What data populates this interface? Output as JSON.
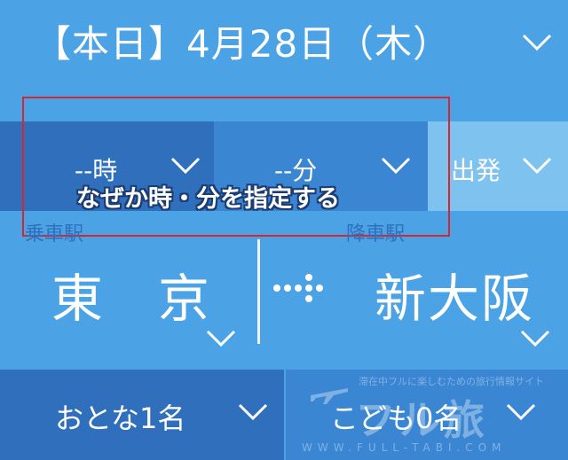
{
  "date_selector": {
    "label": "【本日】4月28日（木）",
    "icon": "chevron-down-icon"
  },
  "time_selector": {
    "hour_value": "--時",
    "minute_value": "--分",
    "type_value": "出発"
  },
  "annotation": {
    "text": "なぜか時・分を指定する",
    "border_color": "#d8262b"
  },
  "stations": {
    "departure_label": "乗車駅",
    "departure_name": "東　京",
    "arrival_label": "降車駅",
    "arrival_name": "新大阪",
    "arrow_icon": "dotted-arrow-right-icon"
  },
  "passengers": {
    "adult_label": "おとな1名",
    "child_label": "こども0名"
  },
  "watermark": {
    "tagline": "滞在中フルに楽しむための旅行情報サイト",
    "logo": "フル旅",
    "url": "WWW.FULL-TABI.COM"
  },
  "colors": {
    "background": "#4ba3e6",
    "dark_blue": "#2f6fbc",
    "mid_blue": "#3a86d3",
    "light_blue": "#7ec2f0",
    "annotation_red": "#d8262b"
  }
}
